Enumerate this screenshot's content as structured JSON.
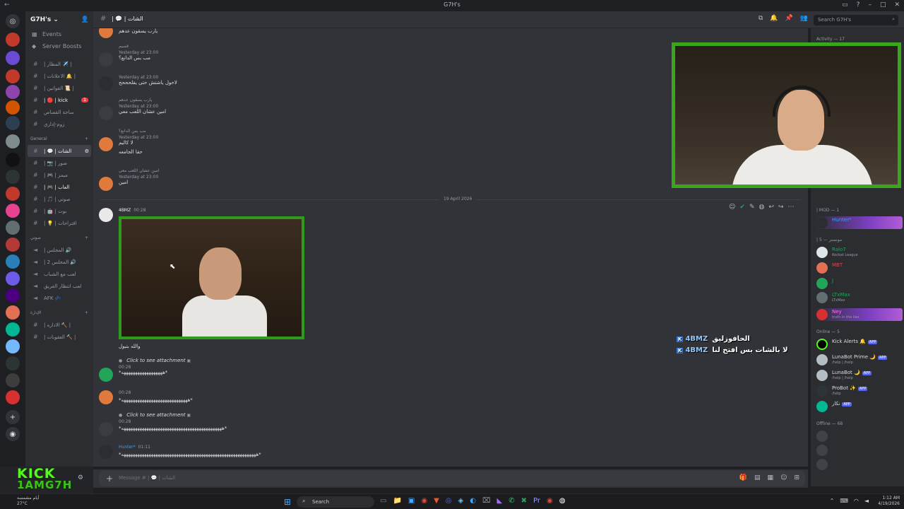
{
  "window": {
    "title": "G7H's"
  },
  "guild": {
    "name": "G7H's"
  },
  "nav": [
    {
      "label": "Events",
      "icon": "calendar-icon"
    },
    {
      "label": "Server Boosts",
      "icon": "boost-icon"
    }
  ],
  "channels_top": [
    {
      "label": "| المطار ✈️ |"
    },
    {
      "label": "| الاعلانات 🔔 |"
    },
    {
      "label": "| القوانين 📜 |"
    },
    {
      "label": "| 🔴 | kick",
      "badge": "1"
    },
    {
      "label": "ساحة القصاص"
    },
    {
      "label": "زوم-إداري"
    }
  ],
  "category_general": "General",
  "channels_general": [
    {
      "label": "| 💬 | الشات",
      "active": true
    },
    {
      "label": "| 📷 | صور"
    },
    {
      "label": "| 🎮 | ميمز"
    },
    {
      "label": "| 🎮 | العاب"
    },
    {
      "label": "| 🎵 | صوتي"
    },
    {
      "label": "| 🤖 | بوت"
    },
    {
      "label": "| 💡 | اقتراحات"
    }
  ],
  "category_voice": "صوتي",
  "channels_voice": [
    {
      "label": "| المجلس 🔊"
    },
    {
      "label": "| المجلس 2 🔊"
    },
    {
      "label": "لعب مع الشباب"
    },
    {
      "label": "لعب انتظار الفريق"
    },
    {
      "label": "AFK 💤"
    }
  ],
  "category_admin": "الإدارة",
  "channels_admin": [
    {
      "label": "| الاداره 🔨 |"
    },
    {
      "label": "| العقوبات 🔨 |"
    }
  ],
  "header": {
    "channel": "| 💬 | الشات",
    "search_placeholder": "Search G7H's"
  },
  "messages": {
    "m1": {
      "text": "يارب يسقون عدهم"
    },
    "m2": {
      "reply": "قسيم",
      "time": "Yesterday at 23:00",
      "text": "مب بس الدانع؟"
    },
    "m3": {
      "time": "Yesterday at 23:00",
      "text": "لاحول ياشتش حتى يقلحححح"
    },
    "m4": {
      "reply": "يارب يسقون عدهم",
      "time": "Yesterday at 23:00",
      "text": "امين عشان اللعب معي"
    },
    "m5": {
      "reply": "مب بس الدانع؟",
      "time": "Yesterday at 23:00",
      "text1": "لا كاليم",
      "text2": "حقا الجامعه"
    },
    "m6": {
      "reply": "امين عشان اللعب معي",
      "time": "Yesterday at 23:00",
      "text": "امين"
    },
    "date_divider": "19 April 2026",
    "m7": {
      "author": "4BMZ",
      "time": "00:28",
      "caption": "والله بتبول"
    },
    "m8": {
      "click": "Click to see attachment",
      "time": "00:28",
      "text": "*ههههههههههههههههههه*"
    },
    "m9": {
      "time": "00:28",
      "text": "*هههههههههههههههههههههههههههههه*"
    },
    "m10": {
      "click": "Click to see attachment",
      "time": "00:28",
      "text": "*ههههههههههههههههههههههههههههههههههههههههههههه*"
    },
    "m11": {
      "author": "Hunter*",
      "time": "01:11",
      "text": "*هههههههههههههههههههههههههههههههههههههههههههههههههههههههههههه*"
    }
  },
  "composer": {
    "placeholder": "Message # | 💬 | الشات"
  },
  "members": {
    "activity": "Activity — 17",
    "mod_cat": "| MOD — 1",
    "mod": [
      {
        "name": "Hunter*"
      }
    ],
    "mods_cat": "| مونستر — 5",
    "group": [
      {
        "name": "Ralo7",
        "sub": "Rocket League"
      },
      {
        "name": "MBT",
        "sub": ""
      },
      {
        "name": "J",
        "sub": ""
      },
      {
        "name": "LTxMax",
        "sub": "LTxMax"
      },
      {
        "name": "Ney",
        "sub": "truth in the lies"
      }
    ],
    "online_cat": "Online — 5",
    "bots": [
      {
        "name": "Kick Alerts 🔔",
        "app": "APP",
        "sub": ""
      },
      {
        "name": "LunaBot Prime 🌙",
        "app": "APP",
        "sub": "/help | /help"
      },
      {
        "name": "LunaBot 🌙",
        "app": "APP",
        "sub": "/help | /help"
      },
      {
        "name": "ProBot ✨",
        "app": "APP",
        "sub": "/help"
      },
      {
        "name": "نكار",
        "app": "APP",
        "sub": ""
      }
    ],
    "offline_cat": "Offline — 68"
  },
  "overlay": [
    {
      "tag": "4BMZ",
      "text": "الحافوزليق"
    },
    {
      "tag": "4BMZ",
      "text": "لا بالشات بس افتح لنا"
    }
  ],
  "user_panel": {
    "logo_line1": "KICK",
    "logo_line2": "1AMG7H"
  },
  "taskbar": {
    "weather_temp": "27°C",
    "weather_text": "أيام مشمسة",
    "search": "Search",
    "time": "1:12 AM",
    "date": "4/19/2026"
  }
}
